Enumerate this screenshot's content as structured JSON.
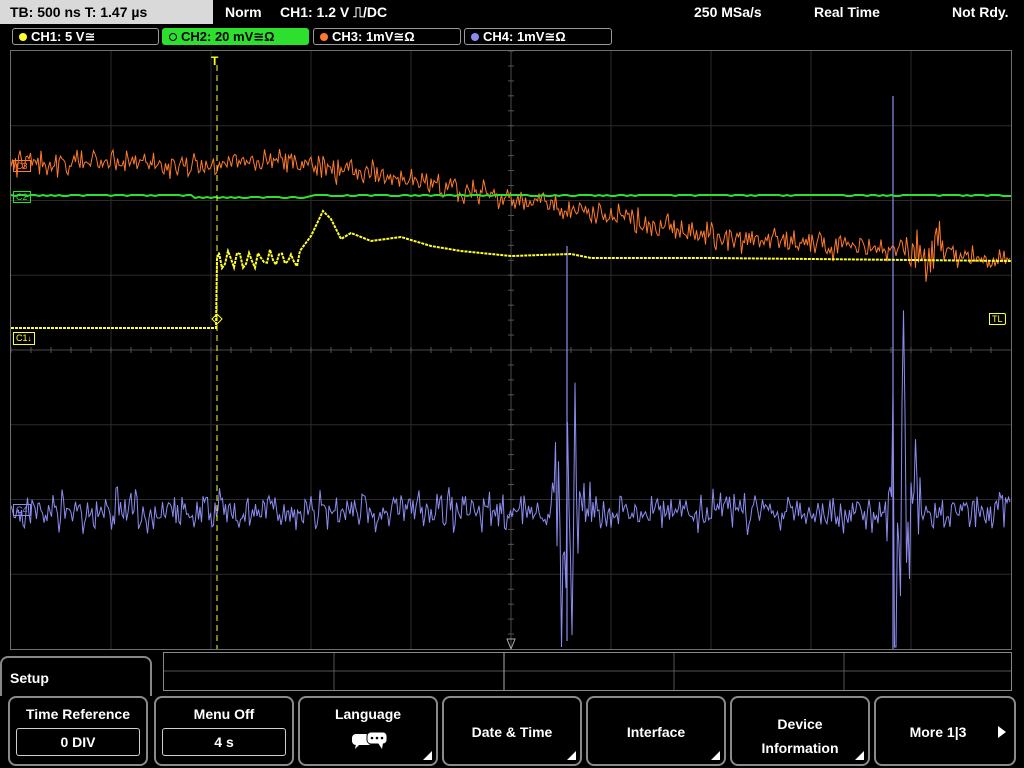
{
  "topbar": {
    "timebase": "TB: 500 ns   T: 1.47 µs",
    "trigger_mode": "Norm",
    "trigger_info": "CH1: 1.2 V ⎍/DC",
    "sample_rate": "250 MSa/s",
    "acq_mode": "Real Time",
    "status": "Not Rdy."
  },
  "channels": [
    {
      "label": "CH1: 5 V≅",
      "color": "#ffff2a",
      "active": false
    },
    {
      "label": "CH2: 20 mV≅Ω",
      "color": "#2ee02e",
      "active": true
    },
    {
      "label": "CH3: 1mV≅Ω",
      "color": "#ff7a2a",
      "active": false
    },
    {
      "label": "CH4: 1mV≅Ω",
      "color": "#8c8cf0",
      "active": false
    }
  ],
  "scope": {
    "trigger_marker": "T",
    "ch1_marker": "C1",
    "ch2_marker": "C2",
    "ch3_marker": "C3",
    "ch4_marker": "C4",
    "trigger_level_marker": "TL"
  },
  "menu": {
    "title": "Setup",
    "softkeys": [
      {
        "label": "Time Reference",
        "value": "0 DIV"
      },
      {
        "label": "Menu Off",
        "value": "4 s"
      },
      {
        "label": "Language",
        "icon": "speech-bubbles-icon"
      },
      {
        "label": "Date & Time"
      },
      {
        "label": "Interface"
      },
      {
        "label": "Device\nInformation"
      },
      {
        "label": "More 1|3"
      }
    ]
  }
}
